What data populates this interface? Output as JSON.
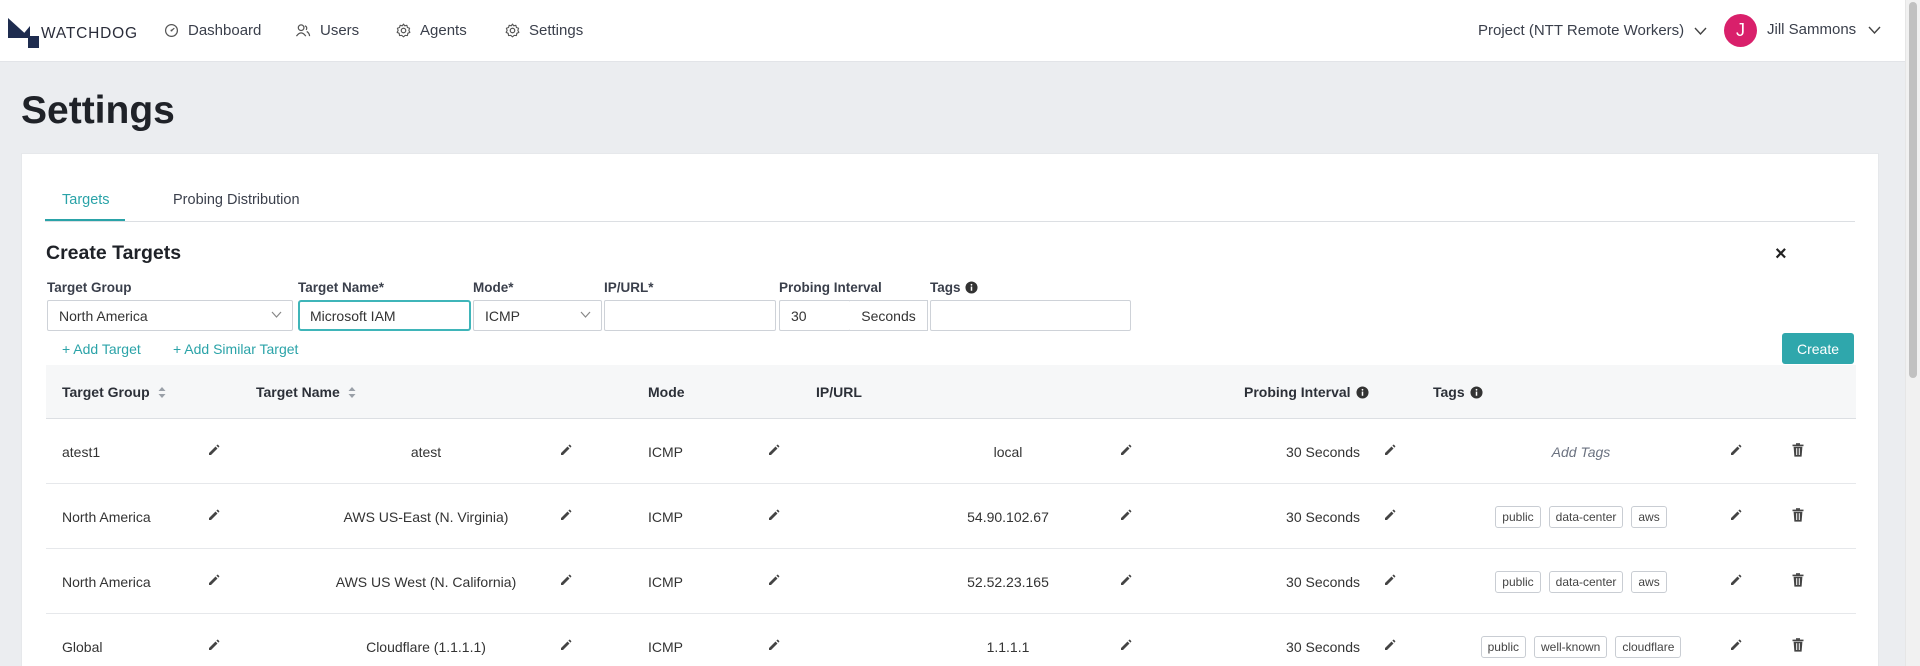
{
  "nav": {
    "brand": "WATCHDOG",
    "items": [
      {
        "label": "Dashboard",
        "icon": "dashboard-icon"
      },
      {
        "label": "Users",
        "icon": "users-icon"
      },
      {
        "label": "Agents",
        "icon": "gear-icon"
      },
      {
        "label": "Settings",
        "icon": "gear-icon"
      }
    ],
    "project": "Project (NTT Remote Workers)",
    "avatar_initial": "J",
    "user_name": "Jill Sammons"
  },
  "page": {
    "title": "Settings"
  },
  "tabs": [
    {
      "label": "Targets",
      "active": true
    },
    {
      "label": "Probing Distribution",
      "active": false
    }
  ],
  "create": {
    "title": "Create Targets",
    "close": "×",
    "labels": {
      "target_group": "Target Group",
      "target_name": "Target Name*",
      "mode": "Mode*",
      "ip_url": "IP/URL*",
      "probing_interval": "Probing Interval",
      "tags": "Tags"
    },
    "values": {
      "target_group": "North America",
      "target_name": "Microsoft IAM",
      "mode": "ICMP",
      "ip_url": "",
      "interval": "30",
      "interval_unit": "Seconds",
      "tags": ""
    },
    "add_target": "+ Add Target",
    "add_similar": "+ Add Similar Target",
    "create_button": "Create"
  },
  "table": {
    "headers": {
      "target_group": "Target Group",
      "target_name": "Target Name",
      "mode": "Mode",
      "ip_url": "IP/URL",
      "probing_interval": "Probing Interval",
      "tags": "Tags"
    },
    "rows": [
      {
        "group": "atest1",
        "name": "atest",
        "mode": "ICMP",
        "ip": "local",
        "interval": "30 Seconds",
        "tags": [],
        "add_tags": "Add Tags"
      },
      {
        "group": "North America",
        "name": "AWS US-East (N. Virginia)",
        "mode": "ICMP",
        "ip": "54.90.102.67",
        "interval": "30 Seconds",
        "tags": [
          "public",
          "data-center",
          "aws"
        ]
      },
      {
        "group": "North America",
        "name": "AWS US West (N. California)",
        "mode": "ICMP",
        "ip": "52.52.23.165",
        "interval": "30 Seconds",
        "tags": [
          "public",
          "data-center",
          "aws"
        ]
      },
      {
        "group": "Global",
        "name": "Cloudflare (1.1.1.1)",
        "mode": "ICMP",
        "ip": "1.1.1.1",
        "interval": "30 Seconds",
        "tags": [
          "public",
          "well-known",
          "cloudflare"
        ]
      }
    ]
  },
  "colors": {
    "accent": "#2aa3a8",
    "avatar": "#d9206b",
    "logo": "#1e2c4f"
  }
}
